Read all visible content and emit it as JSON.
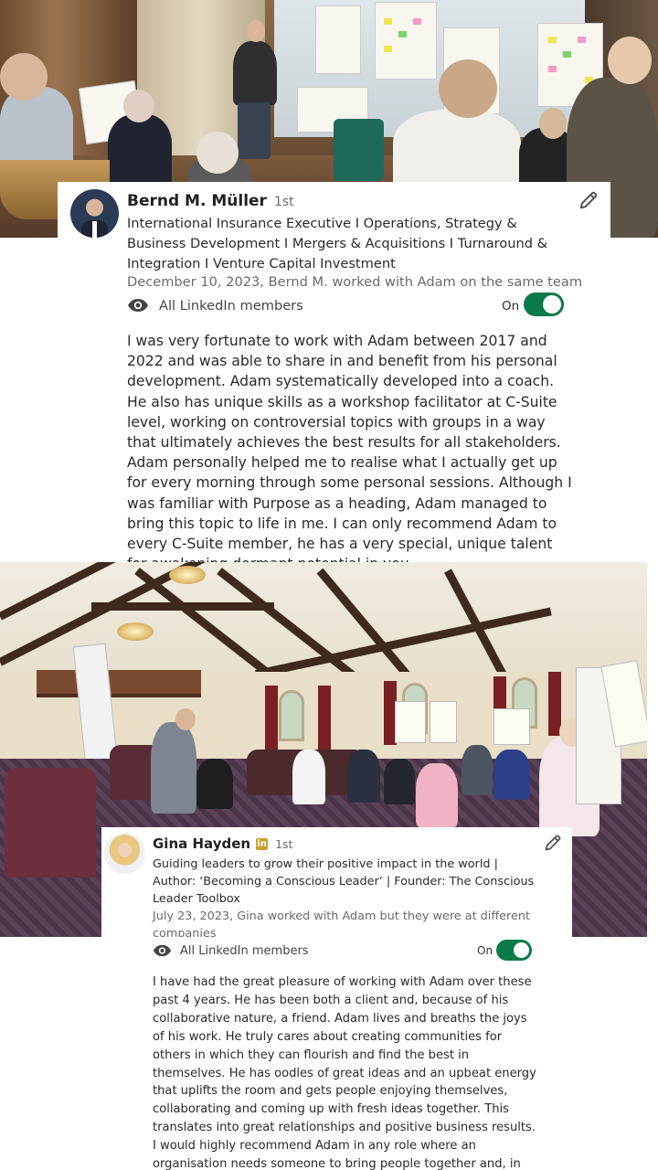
{
  "recommendations": [
    {
      "name": "Bernd M. Müller",
      "degree": "1st",
      "headline": "International Insurance Executive I Operations, Strategy & Business Development I Mergers & Acquisitions I Turnaround & Integration I Venture Capital Investment",
      "meta": "December 10, 2023, Bernd M. worked with Adam on the same team",
      "visibility": "All LinkedIn members",
      "toggle_label": "On",
      "text": "I was very fortunate to work with Adam between 2017 and 2022 and was able to share in and benefit from his personal development. Adam systematically developed into a coach. He also has unique skills as a workshop facilitator at C-Suite level, working on controversial topics with groups in a way that ultimately achieves the best results for all stakeholders. Adam personally helped me to realise what I actually get up for every morning through some personal sessions. Although I was familiar with Purpose as a heading, Adam managed to bring this topic to life in me. I can only recommend Adam to every C-Suite member, he has a very special, unique talent for awakening dormant potential in you."
    },
    {
      "name": "Gina Hayden",
      "badge": "in",
      "degree": "1st",
      "headline": "Guiding leaders to grow their positive impact in the world | Author: ‘Becoming a Conscious Leader’ | Founder: The Conscious Leader Toolbox",
      "meta": "July 23, 2023, Gina worked with Adam but they were at different companies",
      "visibility": "All LinkedIn members",
      "toggle_label": "On",
      "text": "I have had the great pleasure of working with Adam over these past 4 years. He has been both a client and, because of his collaborative nature, a friend. Adam lives and breaths the joys of his work. He truly cares about creating communities for others in which they can flourish and find the best in themselves. He has oodles of great ideas and an upbeat energy that uplifts the room and gets people enjoying themselves, collaborating and coming up with fresh ideas together. This translates into great relationships and positive business results. I would highly recommend Adam in any role where an organisation needs someone to bring people together and, in working together, to achieve more than they thought was possible."
    }
  ],
  "icons": {
    "edit": "pencil-icon",
    "visibility": "eye-icon",
    "linkedin_badge": "linkedin-premium-icon"
  },
  "colors": {
    "toggle_on": "#0b7a4a",
    "text": "#2a2a2a",
    "muted": "#6a6a6a",
    "premium_badge": "#caa12c"
  }
}
